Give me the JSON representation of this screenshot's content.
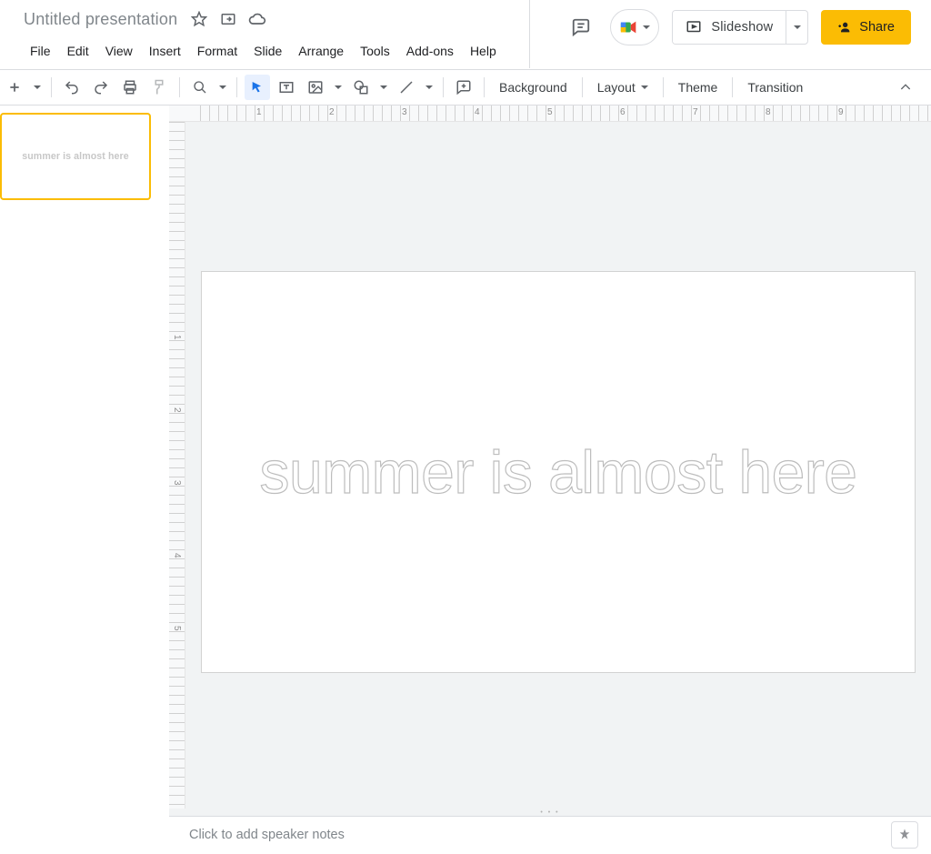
{
  "header": {
    "title": "Untitled presentation"
  },
  "menu": {
    "file": "File",
    "edit": "Edit",
    "view": "View",
    "insert": "Insert",
    "format": "Format",
    "slide": "Slide",
    "arrange": "Arrange",
    "tools": "Tools",
    "addons": "Add-ons",
    "help": "Help"
  },
  "actions": {
    "slideshow": "Slideshow",
    "share": "Share"
  },
  "toolbar": {
    "background": "Background",
    "layout": "Layout",
    "theme": "Theme",
    "transition": "Transition"
  },
  "ruler": {
    "h": [
      "1",
      "2",
      "3",
      "4",
      "5",
      "6",
      "7",
      "8",
      "9"
    ],
    "v": [
      "1",
      "2",
      "3",
      "4",
      "5"
    ]
  },
  "slide": {
    "text": "summer is almost here"
  },
  "thumbnail": {
    "text": "summer is almost here"
  },
  "notes": {
    "placeholder": "Click to add speaker notes"
  }
}
